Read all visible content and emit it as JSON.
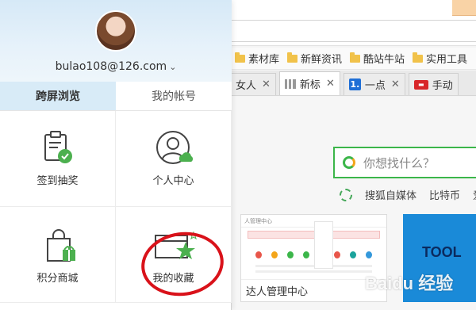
{
  "browser": {
    "bookmarks": [
      "素材库",
      "新鲜资讯",
      "酷站牛站",
      "实用工具"
    ],
    "tabs": [
      {
        "label": "女人",
        "icon": "partial-tab"
      },
      {
        "label": "新标",
        "icon": "grid-icon",
        "active": true
      },
      {
        "label": "一点",
        "icon": "number-one-icon"
      },
      {
        "label": "手动",
        "icon": "red-logo-icon"
      }
    ],
    "search_placeholder": "你想找什么？",
    "links": [
      "搜狐自媒体",
      "比特币",
      "爱"
    ],
    "tile1_caption": "达人管理中心",
    "tile1_header": "人管理中心",
    "tile2_text": "TOOL",
    "watermark": "Baidu 经验"
  },
  "account": {
    "email": "bulao108@126.com",
    "tabs": [
      {
        "label": "跨屏浏览",
        "active": true
      },
      {
        "label": "我的帐号",
        "active": false
      }
    ],
    "items": [
      {
        "label": "签到抽奖",
        "icon": "clipboard-check-icon"
      },
      {
        "label": "个人中心",
        "icon": "user-cloud-icon"
      },
      {
        "label": "积分商城",
        "icon": "shopping-bag-gift-icon"
      },
      {
        "label": "我的收藏",
        "icon": "folder-star-icon"
      }
    ]
  },
  "colors": {
    "accent_green": "#3cb64a",
    "annotation_red": "#d9121a",
    "panel_header": "#d8ebf7"
  }
}
